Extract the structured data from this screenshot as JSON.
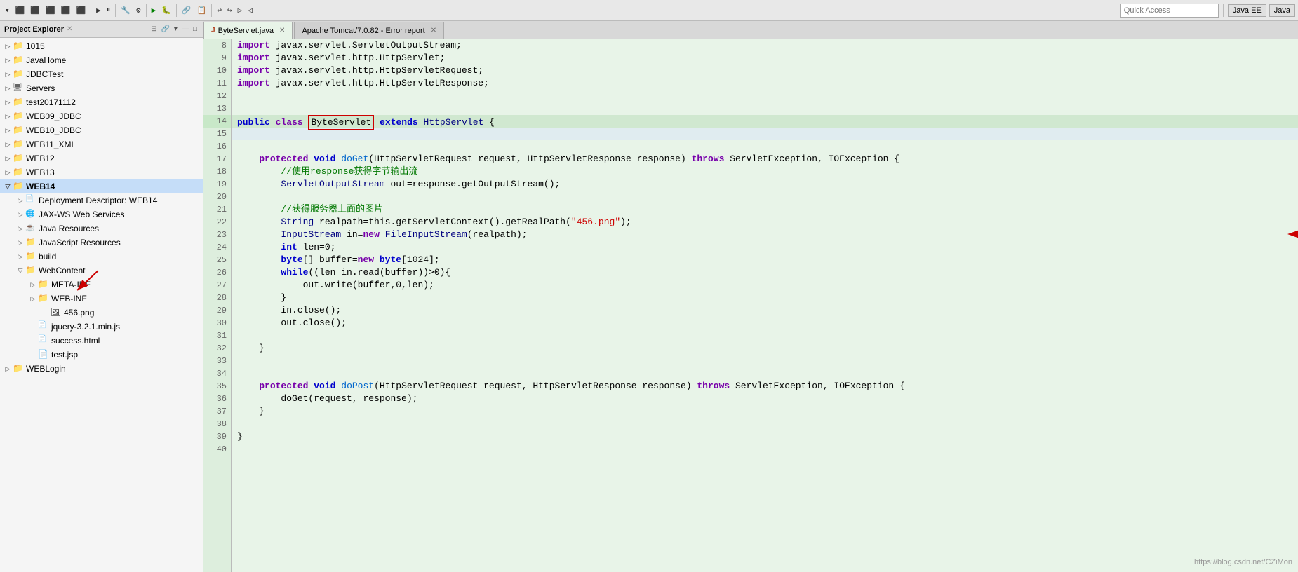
{
  "toolbar": {
    "quick_access_placeholder": "Quick Access",
    "perspective1": "Java EE",
    "perspective2": "Java"
  },
  "project_explorer": {
    "title": "Project Explorer",
    "items": [
      {
        "id": "1015",
        "label": "1015",
        "level": 0,
        "expanded": false,
        "type": "project"
      },
      {
        "id": "JavaHome",
        "label": "JavaHome",
        "level": 0,
        "expanded": false,
        "type": "project"
      },
      {
        "id": "JDBCTest",
        "label": "JDBCTest",
        "level": 0,
        "expanded": false,
        "type": "project"
      },
      {
        "id": "Servers",
        "label": "Servers",
        "level": 0,
        "expanded": false,
        "type": "project"
      },
      {
        "id": "test20171112",
        "label": "test20171112",
        "level": 0,
        "expanded": false,
        "type": "project"
      },
      {
        "id": "WEB09_JDBC",
        "label": "WEB09_JDBC",
        "level": 0,
        "expanded": false,
        "type": "project"
      },
      {
        "id": "WEB10_JDBC",
        "label": "WEB10_JDBC",
        "level": 0,
        "expanded": false,
        "type": "project"
      },
      {
        "id": "WEB11_XML",
        "label": "WEB11_XML",
        "level": 0,
        "expanded": false,
        "type": "project"
      },
      {
        "id": "WEB12",
        "label": "WEB12",
        "level": 0,
        "expanded": false,
        "type": "project"
      },
      {
        "id": "WEB13",
        "label": "WEB13",
        "level": 0,
        "expanded": false,
        "type": "project"
      },
      {
        "id": "WEB14",
        "label": "WEB14",
        "level": 0,
        "expanded": true,
        "type": "project",
        "selected": true
      },
      {
        "id": "DeploymentDescriptor",
        "label": "Deployment Descriptor: WEB14",
        "level": 1,
        "expanded": false,
        "type": "xml"
      },
      {
        "id": "JAXWSWebServices",
        "label": "JAX-WS Web Services",
        "level": 1,
        "expanded": false,
        "type": "resource"
      },
      {
        "id": "JavaResources",
        "label": "Java Resources",
        "level": 1,
        "expanded": false,
        "type": "resource"
      },
      {
        "id": "JavaScriptResources",
        "label": "JavaScript Resources",
        "level": 1,
        "expanded": false,
        "type": "resource"
      },
      {
        "id": "build",
        "label": "build",
        "level": 1,
        "expanded": false,
        "type": "folder"
      },
      {
        "id": "WebContent",
        "label": "WebContent",
        "level": 1,
        "expanded": true,
        "type": "folder"
      },
      {
        "id": "META-INF",
        "label": "META-INF",
        "level": 2,
        "expanded": false,
        "type": "folder"
      },
      {
        "id": "WEB-INF",
        "label": "WEB-INF",
        "level": 2,
        "expanded": false,
        "type": "folder"
      },
      {
        "id": "456png",
        "label": "456.png",
        "level": 3,
        "expanded": false,
        "type": "file"
      },
      {
        "id": "jquery",
        "label": "jquery-3.2.1.min.js",
        "level": 2,
        "expanded": false,
        "type": "js"
      },
      {
        "id": "success",
        "label": "success.html",
        "level": 2,
        "expanded": false,
        "type": "html"
      },
      {
        "id": "testjsp",
        "label": "test.jsp",
        "level": 2,
        "expanded": false,
        "type": "file"
      },
      {
        "id": "WEBLogin",
        "label": "WEBLogin",
        "level": 0,
        "expanded": false,
        "type": "project"
      }
    ]
  },
  "tabs": [
    {
      "label": "ByteServlet.java",
      "active": true
    },
    {
      "label": "Apache Tomcat/7.0.82 - Error report",
      "active": false
    }
  ],
  "code": {
    "lines": [
      {
        "num": 8,
        "content": "import javax.servlet.ServletOutputStream;"
      },
      {
        "num": 9,
        "content": "import javax.servlet.http.HttpServlet;"
      },
      {
        "num": 10,
        "content": "import javax.servlet.http.HttpServletRequest;"
      },
      {
        "num": 11,
        "content": "import javax.servlet.http.HttpServletResponse;"
      },
      {
        "num": 12,
        "content": ""
      },
      {
        "num": 13,
        "content": ""
      },
      {
        "num": 14,
        "content": "public class ByteServlet extends HttpServlet {",
        "highlight": true,
        "current": true
      },
      {
        "num": 15,
        "content": ""
      },
      {
        "num": 16,
        "content": ""
      },
      {
        "num": 17,
        "content": "    protected void doGet(HttpServletRequest request, HttpServletResponse response) throws ServletException, IOException {"
      },
      {
        "num": 18,
        "content": "        //使用response获得字节输出流"
      },
      {
        "num": 19,
        "content": "        ServletOutputStream out=response.getOutputStream();"
      },
      {
        "num": 20,
        "content": ""
      },
      {
        "num": 21,
        "content": "        //获得服务器上面的图片"
      },
      {
        "num": 22,
        "content": "        String realpath=this.getServletContext().getRealPath(\"456.png\");"
      },
      {
        "num": 23,
        "content": "        InputStream in=new FileInputStream(realpath);"
      },
      {
        "num": 24,
        "content": "        int len=0;"
      },
      {
        "num": 25,
        "content": "        byte[] buffer=new byte[1024];"
      },
      {
        "num": 26,
        "content": "        while((len=in.read(buffer))>0){"
      },
      {
        "num": 27,
        "content": "            out.write(buffer,0,len);"
      },
      {
        "num": 28,
        "content": "        }"
      },
      {
        "num": 29,
        "content": "        in.close();"
      },
      {
        "num": 30,
        "content": "        out.close();"
      },
      {
        "num": 31,
        "content": ""
      },
      {
        "num": 32,
        "content": "    }"
      },
      {
        "num": 33,
        "content": ""
      },
      {
        "num": 34,
        "content": ""
      },
      {
        "num": 35,
        "content": "    protected void doPost(HttpServletRequest request, HttpServletResponse response) throws ServletException, IOException {"
      },
      {
        "num": 36,
        "content": "        doGet(request, response);"
      },
      {
        "num": 37,
        "content": "    }"
      },
      {
        "num": 38,
        "content": ""
      },
      {
        "num": 39,
        "content": "}"
      },
      {
        "num": 40,
        "content": ""
      }
    ]
  },
  "watermark": "https://blog.csdn.net/CZiMon"
}
